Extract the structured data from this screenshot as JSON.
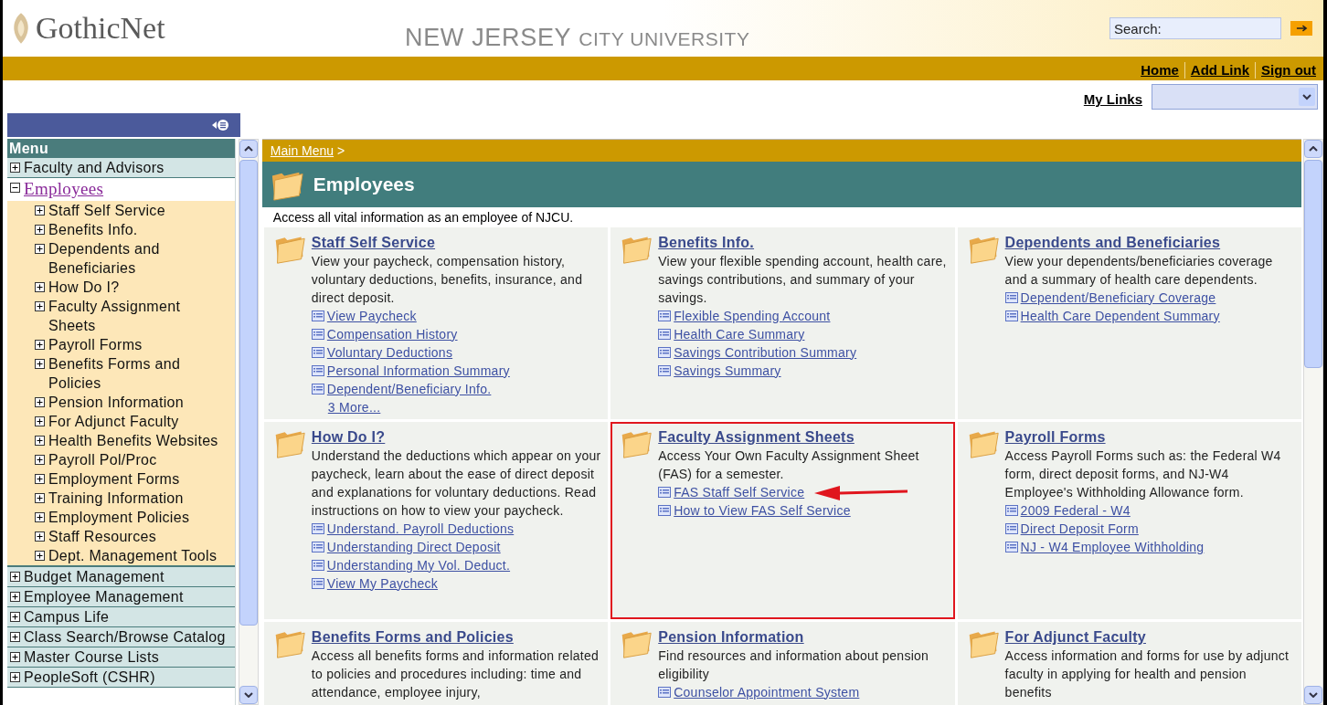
{
  "header": {
    "logo": "GothicNet",
    "university_main": "NEW JERSEY",
    "university_sub": "CITY UNIVERSITY",
    "search": {
      "placeholder": "Search:"
    }
  },
  "top_links": [
    "Home",
    "Add Link",
    "Sign out"
  ],
  "my_links": {
    "label": "My Links"
  },
  "menu": {
    "title": "Menu",
    "items": [
      {
        "label": "Faculty and Advisors",
        "expanded": false,
        "selected": false
      },
      {
        "label": "Employees",
        "expanded": true,
        "selected": true,
        "children": [
          {
            "label": "Staff Self Service",
            "expanded": false
          },
          {
            "label": "Benefits Info.",
            "expanded": false
          },
          {
            "label": "Dependents and Beneficiaries",
            "expanded": false
          },
          {
            "label": "How Do I?",
            "expanded": false
          },
          {
            "label": "Faculty Assignment Sheets",
            "expanded": false
          },
          {
            "label": "Payroll Forms",
            "expanded": false
          },
          {
            "label": "Benefits Forms and Policies",
            "expanded": false
          },
          {
            "label": "Pension Information",
            "expanded": false
          },
          {
            "label": "For Adjunct Faculty",
            "expanded": false
          },
          {
            "label": "Health Benefits Websites",
            "expanded": false
          },
          {
            "label": "Payroll Pol/Proc",
            "expanded": false
          },
          {
            "label": "Employment Forms",
            "expanded": false
          },
          {
            "label": "Training Information",
            "expanded": false
          },
          {
            "label": "Employment Policies",
            "expanded": false
          },
          {
            "label": "Staff Resources",
            "expanded": false
          },
          {
            "label": "Dept. Management Tools",
            "expanded": false
          }
        ]
      },
      {
        "label": "Budget Management",
        "expanded": false,
        "selected": false
      },
      {
        "label": "Employee Management",
        "expanded": false,
        "selected": false
      },
      {
        "label": "Campus Life",
        "expanded": false,
        "selected": false
      },
      {
        "label": "Class Search/Browse Catalog",
        "expanded": false,
        "selected": false
      },
      {
        "label": "Master Course Lists",
        "expanded": false,
        "selected": false
      },
      {
        "label": "PeopleSoft (CSHR)",
        "expanded": false,
        "selected": false
      }
    ]
  },
  "breadcrumb": {
    "link": "Main Menu",
    "separator": ">"
  },
  "page": {
    "title": "Employees",
    "intro": "Access all vital information as an employee of NJCU."
  },
  "cards": [
    {
      "title": "Staff Self Service",
      "description": "View your paycheck, compensation history, voluntary deductions, benefits, insurance, and direct deposit.",
      "highlighted": false,
      "links": [
        {
          "label": "View Paycheck",
          "arrow": false
        },
        {
          "label": "Compensation History",
          "arrow": false
        },
        {
          "label": "Voluntary Deductions",
          "arrow": false
        },
        {
          "label": "Personal Information Summary",
          "arrow": false
        },
        {
          "label": "Dependent/Beneficiary Info.",
          "arrow": false
        }
      ],
      "more": "3 More..."
    },
    {
      "title": "Benefits Info.",
      "description": "View your flexible spending account, health care, savings contributions, and summary of your savings.",
      "highlighted": false,
      "links": [
        {
          "label": "Flexible Spending Account",
          "arrow": false
        },
        {
          "label": "Health Care Summary",
          "arrow": false
        },
        {
          "label": "Savings Contribution Summary",
          "arrow": false
        },
        {
          "label": "Savings Summary",
          "arrow": false
        }
      ]
    },
    {
      "title": "Dependents and Beneficiaries",
      "description": "View your dependents/beneficiaries coverage and a summary of health care dependents.",
      "highlighted": false,
      "links": [
        {
          "label": "Dependent/Beneficiary Coverage",
          "arrow": false
        },
        {
          "label": "Health Care Dependent Summary",
          "arrow": false
        }
      ]
    },
    {
      "title": "How Do I?",
      "description": "Understand the deductions which appear on your paycheck, learn about the ease of direct deposit and explanations for voluntary deductions. Read instructions on how to view your paycheck.",
      "highlighted": false,
      "links": [
        {
          "label": "Understand. Payroll Deductions",
          "arrow": false
        },
        {
          "label": "Understanding Direct Deposit",
          "arrow": false
        },
        {
          "label": "Understanding My Vol. Deduct.",
          "arrow": false
        },
        {
          "label": "View My Paycheck",
          "arrow": false
        }
      ]
    },
    {
      "title": "Faculty Assignment Sheets",
      "description": "Access Your Own Faculty Assignment Sheet (FAS) for a semester.",
      "highlighted": true,
      "links": [
        {
          "label": "FAS Staff Self Service",
          "arrow": true
        },
        {
          "label": "How to View FAS Self Service",
          "arrow": false
        }
      ]
    },
    {
      "title": "Payroll Forms",
      "description": "Access Payroll Forms such as: the Federal W4 form, direct deposit forms, and NJ-W4 Employee's Withholding Allowance form.",
      "highlighted": false,
      "links": [
        {
          "label": "2009 Federal - W4",
          "arrow": false
        },
        {
          "label": "Direct Deposit Form",
          "arrow": false
        },
        {
          "label": "NJ - W4 Employee Withholding",
          "arrow": false
        }
      ]
    },
    {
      "title": "Benefits Forms and Policies",
      "description": "Access all benefits forms and information related to policies and procedures including: time and attendance, employee injury,",
      "highlighted": false
    },
    {
      "title": "Pension Information",
      "description": "Find resources and information about pension eligibility",
      "highlighted": false,
      "links": [
        {
          "label": "Counselor Appointment System",
          "arrow": false
        }
      ]
    },
    {
      "title": "For Adjunct Faculty",
      "description": "Access information and forms for use by adjunct faculty in applying for health and pension benefits",
      "highlighted": false
    }
  ]
}
